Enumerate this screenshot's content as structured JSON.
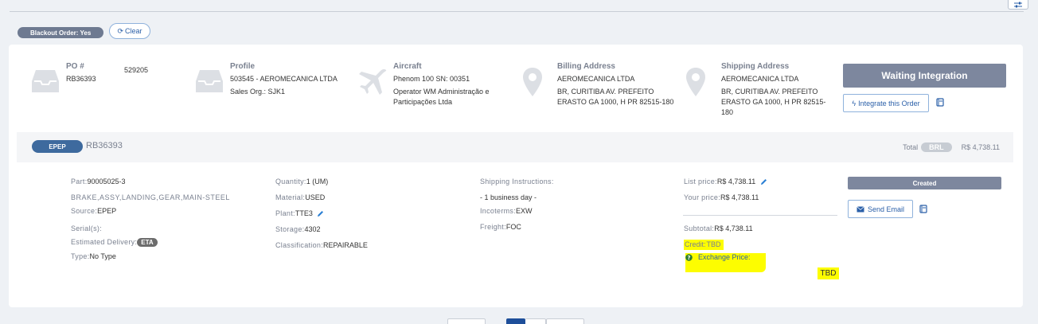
{
  "filters": {
    "blackout_chip": "Blackout Order: Yes",
    "clear_label": "Clear"
  },
  "header": {
    "po": {
      "label": "PO #",
      "number": "529205",
      "ref": "RB36393"
    },
    "profile": {
      "label": "Profile",
      "line1": "503545 - AEROMECANICA LTDA",
      "line2": "Sales Org.: SJK1"
    },
    "aircraft": {
      "label": "Aircraft",
      "line1": "Phenom 100 SN: 00351",
      "line2": "Operator WM Administração e Participações Ltda"
    },
    "billing": {
      "label": "Billing Address",
      "line1": "AEROMECANICA LTDA",
      "line2": "BR, CURITIBA AV. PREFEITO ERASTO GA 1000, H PR 82515-180"
    },
    "shipping": {
      "label": "Shipping Address",
      "line1": "AEROMECANICA LTDA",
      "line2": "BR, CURITIBA AV. PREFEITO ERASTO GA 1000, H PR 82515-180"
    },
    "status": "Waiting Integration",
    "integrate_label": "Integrate this Order"
  },
  "line": {
    "badge": "EPEP",
    "ref": "RB36393",
    "total_label": "Total",
    "currency": "BRL",
    "total": "R$ 4,738.11"
  },
  "item": {
    "part_label": "Part:",
    "part": "90005025-3",
    "description": "BRAKE,ASSY,LANDING,GEAR,MAIN-STEEL",
    "source_label": "Source:",
    "source": "EPEP",
    "serials_label": "Serial(s):",
    "delivery_label": "Estimated Delivery:",
    "delivery_badge": "ETA",
    "type_label": "Type:",
    "type": "No Type",
    "quantity_label": "Quantity:",
    "quantity": "1 (UM)",
    "material_label": "Material:",
    "material": "USED",
    "plant_label": "Plant:",
    "plant": "TTE3",
    "storage_label": "Storage:",
    "storage": "4302",
    "classification_label": "Classification:",
    "classification": "REPAIRABLE",
    "ship_instr_label": "Shipping Instructions:",
    "ship_instr": "- 1 business day -",
    "incoterms_label": "Incoterms:",
    "incoterms": "EXW",
    "freight_label": "Freight:",
    "freight": "FOC",
    "list_price_label": "List price:",
    "list_price": "R$ 4,738.11",
    "your_price_label": "Your price:",
    "your_price": "R$ 4,738.11",
    "subtotal_label": "Subtotal:",
    "subtotal": "R$ 4,738.11",
    "credit_label": "Credit:",
    "credit": "TBD",
    "exchange_label": "Exchange Price:",
    "exchange_value": "TBD",
    "status": "Created",
    "send_email_label": "Send Email"
  },
  "colors": {
    "accent": "#2a5fa8",
    "status_gray": "#7d879e",
    "badge_blue": "#3e6a9e",
    "highlight": "#fdfd00"
  }
}
